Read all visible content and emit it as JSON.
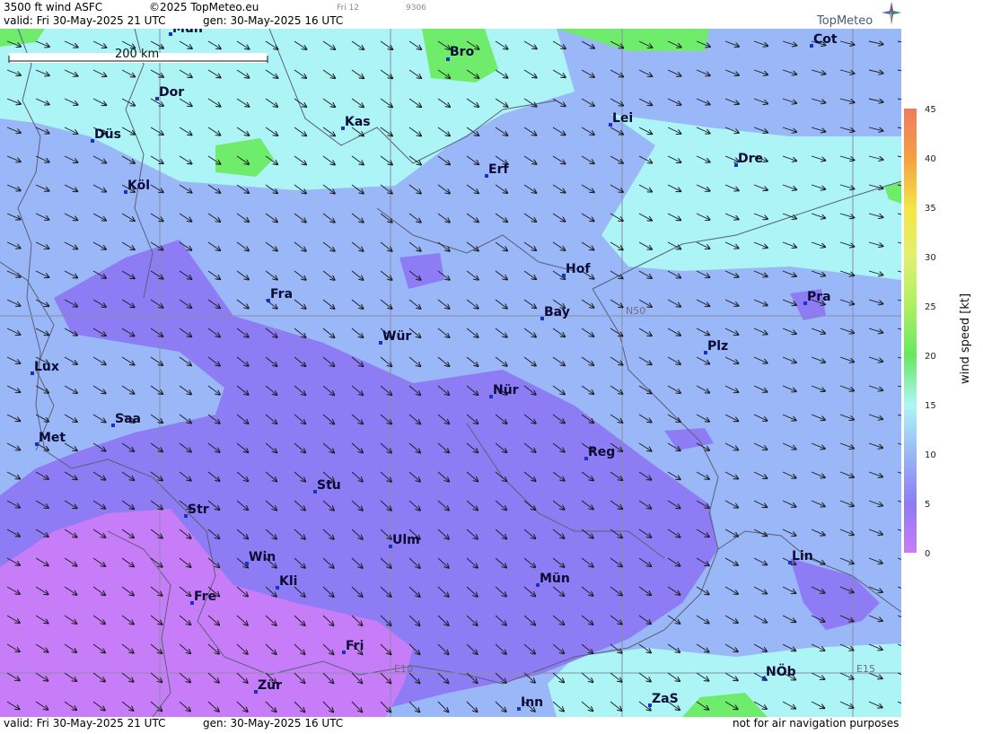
{
  "header": {
    "product": "3500 ft wind ASFC",
    "copyright": "©2025 TopMeteo.eu",
    "valid": "valid:  Fri  30-May-2025  21 UTC",
    "generated": "gen:  30-May-2025 16 UTC",
    "small_tag": "Fri 12",
    "small_id": "9306",
    "logo": "TopMeteo"
  },
  "footer": {
    "valid": "valid:  Fri  30-May-2025  21 UTC",
    "generated": "gen:  30-May-2025 16 UTC",
    "disclaimer": "not for air navigation purposes"
  },
  "map": {
    "scale_label": "200 km",
    "grid_labels": [
      "N50",
      "E10",
      "E15"
    ],
    "cities": [
      "Mün",
      "Bro",
      "Cot",
      "Dor",
      "Kas",
      "Lei",
      "Düs",
      "Erf",
      "Dre",
      "Köl",
      "Hof",
      "Fra",
      "Pra",
      "Bay",
      "Wür",
      "Plz",
      "Lux",
      "Nür",
      "Saa",
      "Met",
      "Reg",
      "Stu",
      "Str",
      "Ulm",
      "Win",
      "Lin",
      "Kli",
      "Mün",
      "Fre",
      "Fri",
      "NÖb",
      "Zür",
      "ZaS",
      "Inn"
    ],
    "colors": {
      "calm": "#c77df7",
      "light": "#8d7cf4",
      "medium": "#9ab7f7",
      "moderate": "#acf4f6",
      "strong": "#70ec6c",
      "border_line": "#5a5f7a",
      "city_marker": "#1533c8"
    }
  },
  "legend": {
    "title": "wind speed [kt]",
    "ticks": [
      "45",
      "40",
      "35",
      "30",
      "25",
      "20",
      "15",
      "10",
      "5",
      "0"
    ],
    "colors": [
      "#f07a60",
      "#f4a040",
      "#f5e544",
      "#e0f070",
      "#aef060",
      "#66e860",
      "#adf6f6",
      "#9ab7f6",
      "#8d7cf4",
      "#c77df7"
    ]
  }
}
